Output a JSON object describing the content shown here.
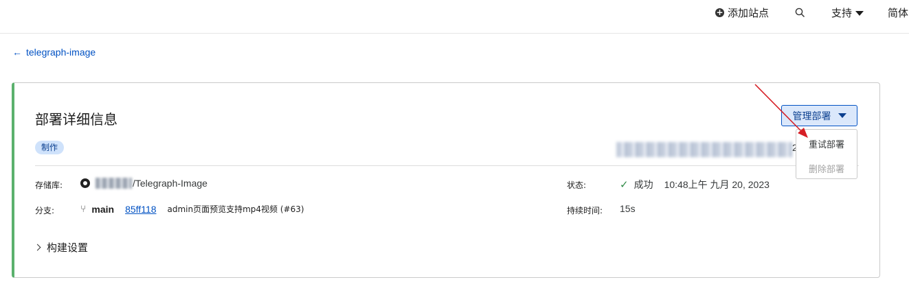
{
  "topbar": {
    "add_site": "添加站点",
    "support": "支持",
    "language": "简体"
  },
  "back_link": {
    "label": "telegraph-image"
  },
  "card": {
    "title": "部署详细信息",
    "badge": "制作",
    "url_suffix": "2",
    "manage_button": "管理部署",
    "dropdown": {
      "retry": "重试部署",
      "delete": "删除部署"
    },
    "repo": {
      "label": "存储库:",
      "value": "/Telegraph-Image"
    },
    "branch": {
      "label": "分支:",
      "name": "main",
      "commit": "85ff118",
      "message": "admin页面预览支持mp4视频 (#63)"
    },
    "status": {
      "label": "状态:",
      "value": "成功",
      "time": "10:48上午 九月 20, 2023"
    },
    "duration": {
      "label": "持续时间:",
      "value": "15s"
    },
    "build_settings": "构建设置"
  },
  "colors": {
    "accent": "#0051c3",
    "success": "#5bb16d",
    "annotation": "#d61f26"
  }
}
